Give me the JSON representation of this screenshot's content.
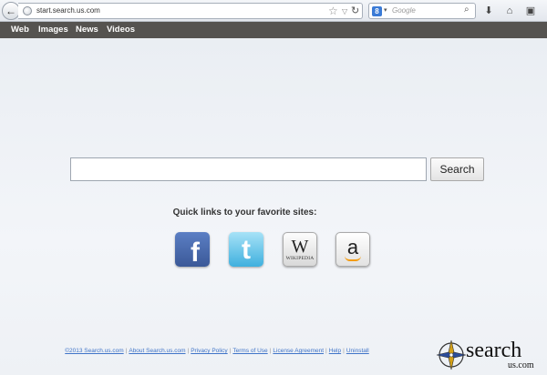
{
  "browser": {
    "url": "start.search.us.com",
    "search_engine": "Google",
    "search_placeholder": "Google"
  },
  "nav": {
    "items": [
      "Web",
      "Images",
      "News",
      "Videos"
    ]
  },
  "main": {
    "search_placeholder": "",
    "search_button": "Search",
    "quick_links_title": "Quick links to your favorite sites:",
    "sites": [
      {
        "name": "Facebook",
        "glyph": "f"
      },
      {
        "name": "Twitter",
        "glyph": "t"
      },
      {
        "name": "Wikipedia",
        "glyph": "W",
        "sub": "WIKIPEDIA"
      },
      {
        "name": "Amazon",
        "glyph": "a"
      }
    ]
  },
  "footer": {
    "links": [
      "©2013 Search.us.com",
      "About Search.us.com",
      "Privacy Policy",
      "Terms of Use",
      "License Agreement",
      "Help",
      "Uninstall"
    ]
  },
  "logo": {
    "word": "search",
    "sub": "us.com"
  },
  "colors": {
    "navbar": "#555350",
    "facebook": "#3b5998",
    "twitter": "#3fb0de",
    "footer_link": "#3f74c8"
  }
}
